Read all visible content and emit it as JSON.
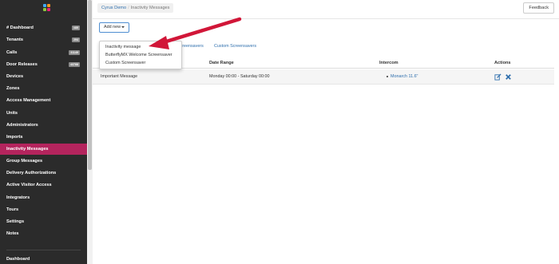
{
  "sidebar": {
    "items": [
      {
        "label": "# Dashboard",
        "badge": "#89"
      },
      {
        "label": "Tenants",
        "badge": "294"
      },
      {
        "label": "Calls",
        "badge": "31149"
      },
      {
        "label": "Door Releases",
        "badge": "43788"
      },
      {
        "label": "Devices",
        "badge": ""
      },
      {
        "label": "Zones",
        "badge": ""
      },
      {
        "label": "Access Management",
        "badge": ""
      },
      {
        "label": "Units",
        "badge": ""
      },
      {
        "label": "Administrators",
        "badge": ""
      },
      {
        "label": "Imports",
        "badge": ""
      },
      {
        "label": "Inactivity Messages",
        "badge": "",
        "active": true
      },
      {
        "label": "Group Messages",
        "badge": ""
      },
      {
        "label": "Delivery Authorizations",
        "badge": ""
      },
      {
        "label": "Active Visitor Access",
        "badge": ""
      },
      {
        "label": "Integrators",
        "badge": ""
      },
      {
        "label": "Tours",
        "badge": ""
      },
      {
        "label": "Settings",
        "badge": ""
      },
      {
        "label": "Notes",
        "badge": ""
      }
    ],
    "footer_label": "Dashboard"
  },
  "breadcrumb": {
    "root": "Cyrus Demo",
    "separator": "/",
    "current": "Inactivity Messages"
  },
  "toolbar": {
    "feedback_label": "Feedback",
    "add_new_label": "Add new"
  },
  "tabs": [
    {
      "label": "...creensavers"
    },
    {
      "label": "Custom Screensavers"
    }
  ],
  "dropdown": {
    "options": [
      "Inactivity message",
      "ButterflyMX Welcome Screensaver",
      "Custom Screensaver"
    ]
  },
  "table": {
    "columns": [
      "Date Range",
      "Intercom",
      "Actions"
    ],
    "rows": [
      {
        "message": "Important Message",
        "date_range": "Monday 00:00 - Saturday 00:00",
        "intercom": "Monarch 11.6\""
      }
    ]
  },
  "colors": {
    "sidebar_bg": "#2b2b2b",
    "active_item": "#b4245d",
    "link": "#2f6fad",
    "arrow": "#d11638"
  }
}
